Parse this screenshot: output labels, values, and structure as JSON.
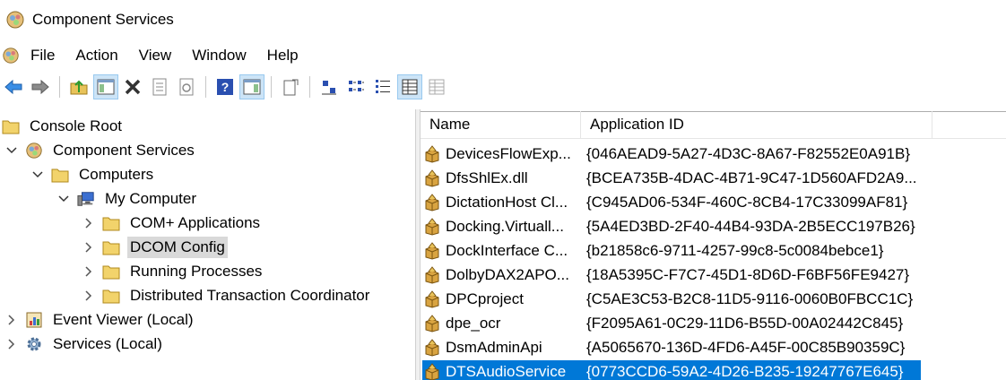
{
  "window": {
    "title": "Component Services"
  },
  "menu": [
    "File",
    "Action",
    "View",
    "Window",
    "Help"
  ],
  "toolbar": [
    "back-arrow-icon",
    "forward-arrow-icon",
    "up-folder-icon",
    "show-hide-console-tree-icon",
    "delete-icon",
    "properties-icon",
    "refresh-icon",
    "help-icon",
    "show-hide-action-pane-icon",
    "export-list-icon",
    "large-icons-view-icon",
    "small-icons-view-icon",
    "list-view-icon",
    "detail-view-icon",
    "status-view-icon"
  ],
  "tree": [
    {
      "label": "Console Root",
      "icon": "folder-icon",
      "level": 0,
      "expander": "none"
    },
    {
      "label": "Component Services",
      "icon": "component-services-icon",
      "level": 1,
      "expander": "expanded"
    },
    {
      "label": "Computers",
      "icon": "folder-icon",
      "level": 2,
      "expander": "expanded"
    },
    {
      "label": "My Computer",
      "icon": "my-computer-icon",
      "level": 3,
      "expander": "expanded"
    },
    {
      "label": "COM+ Applications",
      "icon": "folder-icon",
      "level": 4,
      "expander": "collapsed"
    },
    {
      "label": "DCOM Config",
      "icon": "folder-icon",
      "level": 4,
      "expander": "collapsed",
      "selected": true
    },
    {
      "label": "Running Processes",
      "icon": "folder-icon",
      "level": 4,
      "expander": "collapsed"
    },
    {
      "label": "Distributed Transaction Coordinator",
      "icon": "folder-icon",
      "level": 4,
      "expander": "collapsed"
    },
    {
      "label": "Event Viewer (Local)",
      "icon": "event-viewer-icon",
      "level": 1,
      "expander": "collapsed"
    },
    {
      "label": "Services (Local)",
      "icon": "services-gear-icon",
      "level": 1,
      "expander": "collapsed"
    }
  ],
  "list": {
    "columns": [
      "Name",
      "Application ID"
    ],
    "rows": [
      {
        "name": "DevicesFlowExp...",
        "appid": "{046AEAD9-5A27-4D3C-8A67-F82552E0A91B}"
      },
      {
        "name": "DfsShlEx.dll",
        "appid": "{BCEA735B-4DAC-4B71-9C47-1D560AFD2A9..."
      },
      {
        "name": "DictationHost Cl...",
        "appid": "{C945AD06-534F-460C-8CB4-17C33099AF81}"
      },
      {
        "name": "Docking.Virtuall...",
        "appid": "{5A4ED3BD-2F40-44B4-93DA-2B5ECC197B26}"
      },
      {
        "name": "DockInterface C...",
        "appid": "{b21858c6-9711-4257-99c8-5c0084bebce1}"
      },
      {
        "name": "DolbyDAX2APO...",
        "appid": "{18A5395C-F7C7-45D1-8D6D-F6BF56FE9427}"
      },
      {
        "name": "DPCproject",
        "appid": "{C5AE3C53-B2C8-11D5-9116-0060B0FBCC1C}"
      },
      {
        "name": "dpe_ocr",
        "appid": "{F2095A61-0C29-11D6-B55D-00A02442C845}"
      },
      {
        "name": "DsmAdminApi",
        "appid": "{A5065670-136D-4FD6-A45F-00C85B90359C}"
      },
      {
        "name": "DTSAudioService",
        "appid": "{0773CCD6-59A2-4D26-B235-19247767E645}",
        "selected": true
      }
    ]
  },
  "colors": {
    "selection": "#0078d7",
    "tree_selection": "#d9d9d9",
    "toolbar_active": "#cce4f7"
  }
}
